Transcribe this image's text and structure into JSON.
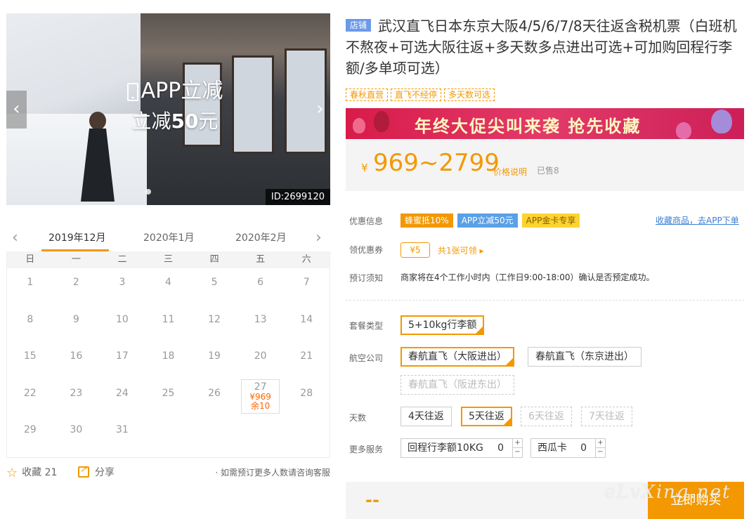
{
  "gallery": {
    "overlay_line1": "APP立减",
    "overlay_line2_prefix": "立减",
    "overlay_line2_amount": "50",
    "overlay_line2_suffix": "元",
    "prev_glyph": "‹",
    "next_glyph": "›",
    "id_badge": "ID:2699120"
  },
  "calendar": {
    "prev_glyph": "‹",
    "next_glyph": "›",
    "months": [
      "2019年12月",
      "2020年1月",
      "2020年2月"
    ],
    "active_month_index": 0,
    "weekdays": [
      "日",
      "一",
      "二",
      "三",
      "四",
      "五",
      "六"
    ],
    "days": [
      {
        "day": "1"
      },
      {
        "day": "2"
      },
      {
        "day": "3"
      },
      {
        "day": "4"
      },
      {
        "day": "5"
      },
      {
        "day": "6"
      },
      {
        "day": "7"
      },
      {
        "day": "8"
      },
      {
        "day": "9"
      },
      {
        "day": "10"
      },
      {
        "day": "11"
      },
      {
        "day": "12"
      },
      {
        "day": "13"
      },
      {
        "day": "14"
      },
      {
        "day": "15"
      },
      {
        "day": "16"
      },
      {
        "day": "17"
      },
      {
        "day": "18"
      },
      {
        "day": "19"
      },
      {
        "day": "20"
      },
      {
        "day": "21"
      },
      {
        "day": "22"
      },
      {
        "day": "23"
      },
      {
        "day": "24"
      },
      {
        "day": "25"
      },
      {
        "day": "26"
      },
      {
        "day": "27",
        "price": "¥969",
        "remain": "余10"
      },
      {
        "day": "28"
      },
      {
        "day": "29"
      },
      {
        "day": "30"
      },
      {
        "day": "31"
      }
    ]
  },
  "footer_left": {
    "favorite_label": "收藏 21",
    "share_label": "分享",
    "hint": "· 如需预订更多人数请咨询客服"
  },
  "product": {
    "store_tag": "店铺",
    "title": "武汉直飞日本东京大阪4/5/6/7/8天往返含税机票（白班机不熬夜+可选大阪往返+多天数多点进出可选+可加购回程行李额/多单项可选）",
    "tags": [
      "春秋直营",
      "直飞不经停",
      "多天数可选"
    ],
    "banner_text": "年终大促尖叫来袭  抢先收藏",
    "currency": "¥",
    "price_range": "969~2799",
    "price_explain": "价格说明",
    "sold": "已售8"
  },
  "info": {
    "promo_label": "优惠信息",
    "promos": [
      {
        "text": "蜂蜜抵10%",
        "bg": "#f39800",
        "fg": "#ffffff"
      },
      {
        "text": "APP立减50元",
        "bg": "#5aa0e6",
        "fg": "#ffffff"
      },
      {
        "text": "APP金卡专享",
        "bg": "#fbd430",
        "fg": "#8a5a00"
      }
    ],
    "fav_app_link": "收藏商品，去APP下单",
    "coupon_label": "领优惠券",
    "coupon_value": "¥5",
    "coupon_link": "共1张可领 ▸",
    "notice_label": "预订须知",
    "notice_text": "商家将在4个工作小时内（工作日9:00-18:00）确认是否预定成功。"
  },
  "options": {
    "package_label": "套餐类型",
    "package_opts": [
      "5+10kg行李额"
    ],
    "airline_label": "航空公司",
    "airline_opts": [
      "春航直飞（大阪进出）",
      "春航直飞（东京进出）",
      "春航直飞（阪进东出）"
    ],
    "days_label": "天数",
    "days_opts": [
      "4天往返",
      "5天往返",
      "6天往返",
      "7天往返"
    ],
    "service_label": "更多服务",
    "services": [
      {
        "label": "回程行李额10KG",
        "value": "0"
      },
      {
        "label": "西瓜卡",
        "value": "0"
      }
    ],
    "plus": "+",
    "minus": "−"
  },
  "buy": {
    "dash": "--",
    "button": "立即购买"
  },
  "watermark": "eLvXing.net",
  "colors": {
    "accent": "#f39800",
    "link": "#3b7fd4",
    "banner": "#d81b4a"
  }
}
